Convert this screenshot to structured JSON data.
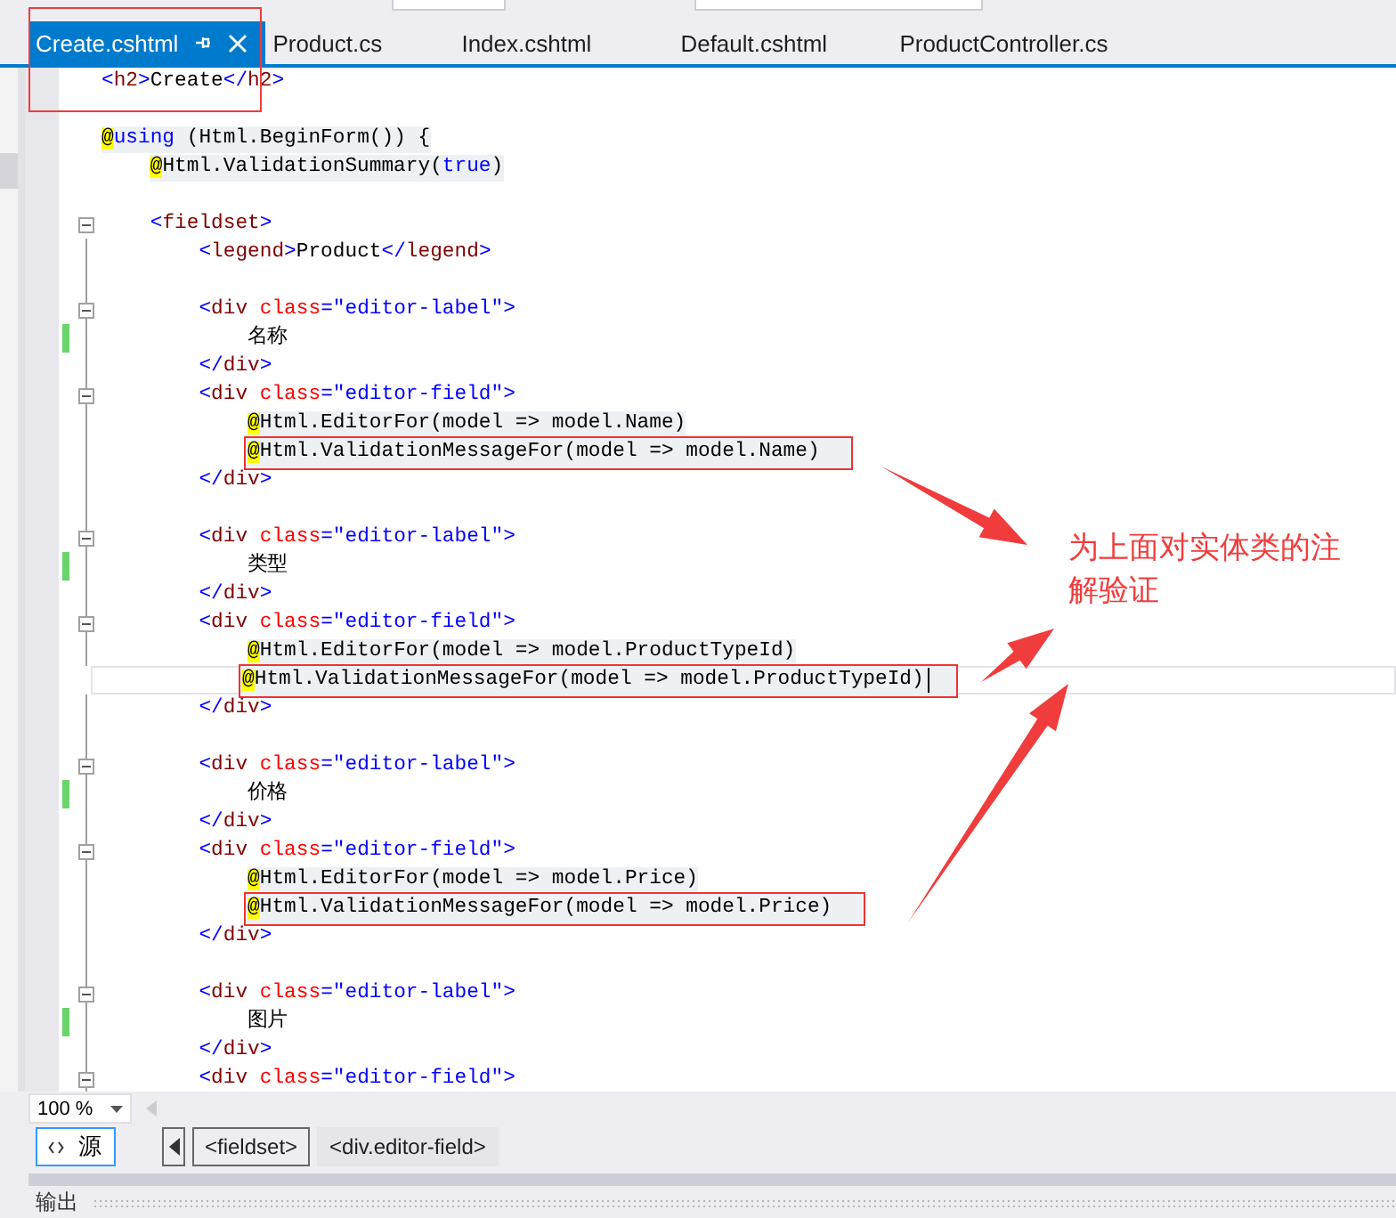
{
  "tabs": [
    {
      "label": "Create.cshtml",
      "selected": true,
      "boxed": true
    },
    {
      "label": "Product.cs",
      "selected": false,
      "boxed": false
    },
    {
      "label": "Index.cshtml",
      "selected": false,
      "boxed": false
    },
    {
      "label": "Default.cshtml",
      "selected": false,
      "boxed": false
    },
    {
      "label": "ProductController.cs",
      "selected": false,
      "boxed": false
    }
  ],
  "lines": [
    {
      "fold": false,
      "changed": false,
      "boxed": false,
      "current": false,
      "tokens": [
        {
          "kind": "punct",
          "text": "<"
        },
        {
          "kind": "tag",
          "text": "h2"
        },
        {
          "kind": "punct",
          "text": ">"
        },
        {
          "kind": "plain",
          "text": "Create"
        },
        {
          "kind": "punct",
          "text": "</"
        },
        {
          "kind": "tag",
          "text": "h2"
        },
        {
          "kind": "punct",
          "text": ">"
        }
      ]
    },
    {
      "fold": false,
      "changed": false,
      "boxed": false,
      "current": false
    },
    {
      "fold": false,
      "changed": false,
      "boxed": false,
      "current": false,
      "tokens": [
        {
          "kind": "at",
          "text": "@"
        },
        {
          "kind": "keyword",
          "text": "using"
        },
        {
          "kind": "plain",
          "text": " (Html.BeginForm()) {"
        }
      ]
    },
    {
      "fold": false,
      "changed": false,
      "boxed": false,
      "current": false,
      "tokens": [
        {
          "kind": "at",
          "text": "    @"
        },
        {
          "kind": "plain",
          "text": "Html.ValidationSummary("
        },
        {
          "kind": "keyword",
          "text": "true"
        },
        {
          "kind": "plain",
          "text": ")"
        }
      ]
    },
    {
      "fold": false,
      "changed": false,
      "boxed": false,
      "current": false
    },
    {
      "fold": true,
      "changed": false,
      "boxed": false,
      "current": false,
      "tokens": [
        {
          "kind": "punct",
          "text": "    <"
        },
        {
          "kind": "tag",
          "text": "fieldset"
        },
        {
          "kind": "punct",
          "text": ">"
        }
      ]
    },
    {
      "fold": false,
      "changed": false,
      "boxed": false,
      "current": false,
      "tokens": [
        {
          "kind": "punct",
          "text": "        <"
        },
        {
          "kind": "tag",
          "text": "legend"
        },
        {
          "kind": "punct",
          "text": ">"
        },
        {
          "kind": "plain",
          "text": "Product"
        },
        {
          "kind": "punct",
          "text": "</"
        },
        {
          "kind": "tag",
          "text": "legend"
        },
        {
          "kind": "punct",
          "text": ">"
        }
      ]
    },
    {
      "fold": false,
      "changed": false,
      "boxed": false,
      "current": false
    },
    {
      "fold": true,
      "changed": false,
      "boxed": false,
      "current": false,
      "tokens": [
        {
          "kind": "punct",
          "text": "        <"
        },
        {
          "kind": "tag",
          "text": "div"
        },
        {
          "kind": "attr",
          "text": " class"
        },
        {
          "kind": "punct",
          "text": "=\"editor-label\">"
        }
      ]
    },
    {
      "fold": false,
      "changed": true,
      "boxed": false,
      "current": false,
      "tokens": [
        {
          "kind": "plain",
          "text": "            名称"
        }
      ]
    },
    {
      "fold": false,
      "changed": false,
      "boxed": false,
      "current": false,
      "tokens": [
        {
          "kind": "punct",
          "text": "        </"
        },
        {
          "kind": "tag",
          "text": "div"
        },
        {
          "kind": "punct",
          "text": ">"
        }
      ]
    },
    {
      "fold": true,
      "changed": false,
      "boxed": false,
      "current": false,
      "tokens": [
        {
          "kind": "punct",
          "text": "        <"
        },
        {
          "kind": "tag",
          "text": "div"
        },
        {
          "kind": "attr",
          "text": " class"
        },
        {
          "kind": "punct",
          "text": "=\"editor-field\">"
        }
      ]
    },
    {
      "fold": false,
      "changed": false,
      "boxed": false,
      "current": false,
      "tokens": [
        {
          "kind": "at",
          "text": "            @"
        },
        {
          "kind": "plain",
          "text": "Html.EditorFor(model => model.Name)"
        }
      ]
    },
    {
      "fold": false,
      "changed": false,
      "boxed": true,
      "current": false,
      "tokens": [
        {
          "kind": "at",
          "text": "            @"
        },
        {
          "kind": "plain",
          "text": "Html.ValidationMessageFor(model => model.Name)"
        }
      ]
    },
    {
      "fold": false,
      "changed": false,
      "boxed": false,
      "current": false,
      "tokens": [
        {
          "kind": "punct",
          "text": "        </"
        },
        {
          "kind": "tag",
          "text": "div"
        },
        {
          "kind": "punct",
          "text": ">"
        }
      ]
    },
    {
      "fold": false,
      "changed": false,
      "boxed": false,
      "current": false
    },
    {
      "fold": true,
      "changed": false,
      "boxed": false,
      "current": false,
      "tokens": [
        {
          "kind": "punct",
          "text": "        <"
        },
        {
          "kind": "tag",
          "text": "div"
        },
        {
          "kind": "attr",
          "text": " class"
        },
        {
          "kind": "punct",
          "text": "=\"editor-label\">"
        }
      ]
    },
    {
      "fold": false,
      "changed": true,
      "boxed": false,
      "current": false,
      "tokens": [
        {
          "kind": "plain",
          "text": "            类型"
        }
      ]
    },
    {
      "fold": false,
      "changed": false,
      "boxed": false,
      "current": false,
      "tokens": [
        {
          "kind": "punct",
          "text": "        </"
        },
        {
          "kind": "tag",
          "text": "div"
        },
        {
          "kind": "punct",
          "text": ">"
        }
      ]
    },
    {
      "fold": true,
      "changed": false,
      "boxed": false,
      "current": false,
      "tokens": [
        {
          "kind": "punct",
          "text": "        <"
        },
        {
          "kind": "tag",
          "text": "div"
        },
        {
          "kind": "attr",
          "text": " class"
        },
        {
          "kind": "punct",
          "text": "=\"editor-field\">"
        }
      ]
    },
    {
      "fold": false,
      "changed": false,
      "boxed": false,
      "current": false,
      "tokens": [
        {
          "kind": "at",
          "text": "            @"
        },
        {
          "kind": "plain",
          "text": "Html.EditorFor(model => model.ProductTypeId)"
        }
      ]
    },
    {
      "fold": false,
      "changed": false,
      "boxed": true,
      "current": true,
      "tokens": [
        {
          "kind": "at",
          "text": "            @"
        },
        {
          "kind": "plain",
          "text": "Html.ValidationMessageFor(model => model.ProductTypeId)"
        }
      ]
    },
    {
      "fold": false,
      "changed": false,
      "boxed": false,
      "current": false,
      "tokens": [
        {
          "kind": "punct",
          "text": "        </"
        },
        {
          "kind": "tag",
          "text": "div"
        },
        {
          "kind": "punct",
          "text": ">"
        }
      ]
    },
    {
      "fold": false,
      "changed": false,
      "boxed": false,
      "current": false
    },
    {
      "fold": true,
      "changed": false,
      "boxed": false,
      "current": false,
      "tokens": [
        {
          "kind": "punct",
          "text": "        <"
        },
        {
          "kind": "tag",
          "text": "div"
        },
        {
          "kind": "attr",
          "text": " class"
        },
        {
          "kind": "punct",
          "text": "=\"editor-label\">"
        }
      ]
    },
    {
      "fold": false,
      "changed": true,
      "boxed": false,
      "current": false,
      "tokens": [
        {
          "kind": "plain",
          "text": "            价格"
        }
      ]
    },
    {
      "fold": false,
      "changed": false,
      "boxed": false,
      "current": false,
      "tokens": [
        {
          "kind": "punct",
          "text": "        </"
        },
        {
          "kind": "tag",
          "text": "div"
        },
        {
          "kind": "punct",
          "text": ">"
        }
      ]
    },
    {
      "fold": true,
      "changed": false,
      "boxed": false,
      "current": false,
      "tokens": [
        {
          "kind": "punct",
          "text": "        <"
        },
        {
          "kind": "tag",
          "text": "div"
        },
        {
          "kind": "attr",
          "text": " class"
        },
        {
          "kind": "punct",
          "text": "=\"editor-field\">"
        }
      ]
    },
    {
      "fold": false,
      "changed": false,
      "boxed": false,
      "current": false,
      "tokens": [
        {
          "kind": "at",
          "text": "            @"
        },
        {
          "kind": "plain",
          "text": "Html.EditorFor(model => model.Price)"
        }
      ]
    },
    {
      "fold": false,
      "changed": false,
      "boxed": true,
      "current": false,
      "tokens": [
        {
          "kind": "at",
          "text": "            @"
        },
        {
          "kind": "plain",
          "text": "Html.ValidationMessageFor(model => model.Price)"
        }
      ]
    },
    {
      "fold": false,
      "changed": false,
      "boxed": false,
      "current": false,
      "tokens": [
        {
          "kind": "punct",
          "text": "        </"
        },
        {
          "kind": "tag",
          "text": "div"
        },
        {
          "kind": "punct",
          "text": ">"
        }
      ]
    },
    {
      "fold": false,
      "changed": false,
      "boxed": false,
      "current": false
    },
    {
      "fold": true,
      "changed": false,
      "boxed": false,
      "current": false,
      "tokens": [
        {
          "kind": "punct",
          "text": "        <"
        },
        {
          "kind": "tag",
          "text": "div"
        },
        {
          "kind": "attr",
          "text": " class"
        },
        {
          "kind": "punct",
          "text": "=\"editor-label\">"
        }
      ]
    },
    {
      "fold": false,
      "changed": true,
      "boxed": false,
      "current": false,
      "tokens": [
        {
          "kind": "plain",
          "text": "            图片"
        }
      ]
    },
    {
      "fold": false,
      "changed": false,
      "boxed": false,
      "current": false,
      "tokens": [
        {
          "kind": "punct",
          "text": "        </"
        },
        {
          "kind": "tag",
          "text": "div"
        },
        {
          "kind": "punct",
          "text": ">"
        }
      ]
    },
    {
      "fold": true,
      "changed": false,
      "boxed": false,
      "current": false,
      "tokens": [
        {
          "kind": "punct",
          "text": "        <"
        },
        {
          "kind": "tag",
          "text": "div"
        },
        {
          "kind": "attr",
          "text": " class"
        },
        {
          "kind": "punct",
          "text": "=\"editor-field\">"
        }
      ]
    }
  ],
  "annotation": "为上面对实体类的注解验证",
  "zoom": "100 %",
  "view_button": "源",
  "breadcrumbs": [
    {
      "label": "<fieldset>",
      "selected": true
    },
    {
      "label": "<div.editor-field>",
      "selected": false
    }
  ],
  "output_panel": {
    "title": "输出"
  }
}
